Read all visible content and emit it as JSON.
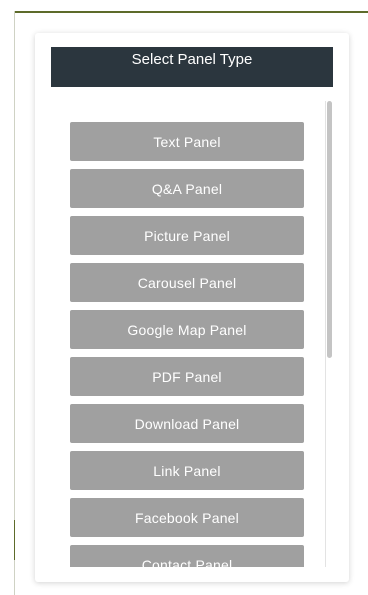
{
  "dialog": {
    "title": "Select Panel Type"
  },
  "panel_types": [
    {
      "label": "Text Panel",
      "name": "text-panel-button"
    },
    {
      "label": "Q&A Panel",
      "name": "qa-panel-button"
    },
    {
      "label": "Picture Panel",
      "name": "picture-panel-button"
    },
    {
      "label": "Carousel Panel",
      "name": "carousel-panel-button"
    },
    {
      "label": "Google Map Panel",
      "name": "google-map-panel-button"
    },
    {
      "label": "PDF Panel",
      "name": "pdf-panel-button"
    },
    {
      "label": "Download Panel",
      "name": "download-panel-button"
    },
    {
      "label": "Link Panel",
      "name": "link-panel-button"
    },
    {
      "label": "Facebook Panel",
      "name": "facebook-panel-button"
    },
    {
      "label": "Contact Panel",
      "name": "contact-panel-button"
    }
  ],
  "colors": {
    "header_bg": "#2b363e",
    "button_bg": "#a0a0a0",
    "button_text": "#ffffff"
  }
}
